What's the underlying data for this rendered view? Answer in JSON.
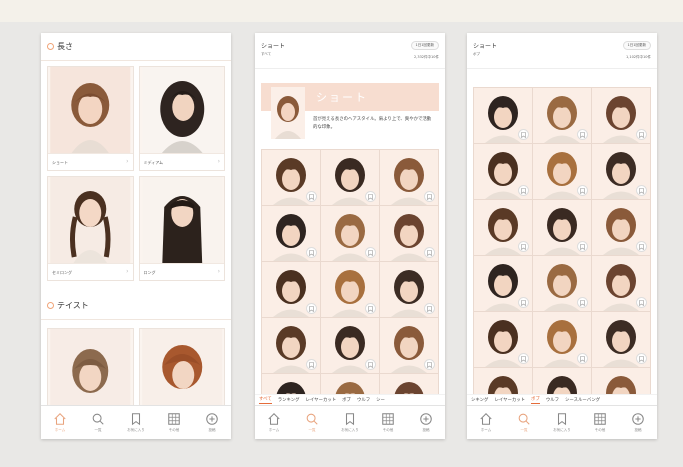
{
  "colors": {
    "accent": "#e8a37d",
    "active": "#e56c3a",
    "tile_bg": "#fbeee6",
    "banner_bg": "#f7ddd0"
  },
  "tabbar": [
    {
      "label": "ホーム",
      "icon": "home-icon"
    },
    {
      "label": "一覧",
      "icon": "search-icon"
    },
    {
      "label": "お気に入り",
      "icon": "bookmark-icon"
    },
    {
      "label": "その他",
      "icon": "grid-icon"
    },
    {
      "label": "投稿",
      "icon": "plus-icon"
    }
  ],
  "screen1": {
    "section_length": "長さ",
    "section_taste": "テイスト",
    "categories": [
      {
        "label": "ショート"
      },
      {
        "label": "ミディアム"
      },
      {
        "label": "セミロング"
      },
      {
        "label": "ロング"
      }
    ]
  },
  "screen2": {
    "title": "ショート",
    "subtitle": "すべて",
    "update_pill": "1日1回更新",
    "count": "2,332件中10件",
    "banner_title": "ショート",
    "banner_desc": "首が見える長さのヘアスタイル。肩より上で、爽やかで活動的な印象。",
    "filters": [
      {
        "label": "すべて",
        "active": true
      },
      {
        "label": "ランキング",
        "active": false
      },
      {
        "label": "レイヤーカット",
        "active": false
      },
      {
        "label": "ボブ",
        "active": false
      },
      {
        "label": "ウルフ",
        "active": false
      },
      {
        "label": "シー",
        "active": false
      }
    ]
  },
  "screen3": {
    "title": "ショート",
    "subtitle": "ボブ",
    "update_pill": "1日1回更新",
    "count": "1,102件中10件",
    "filters": [
      {
        "label": "シキング",
        "active": false
      },
      {
        "label": "レイヤーカット",
        "active": false
      },
      {
        "label": "ボブ",
        "active": true
      },
      {
        "label": "ウルフ",
        "active": false
      },
      {
        "label": "シースルーバング",
        "active": false
      }
    ]
  }
}
